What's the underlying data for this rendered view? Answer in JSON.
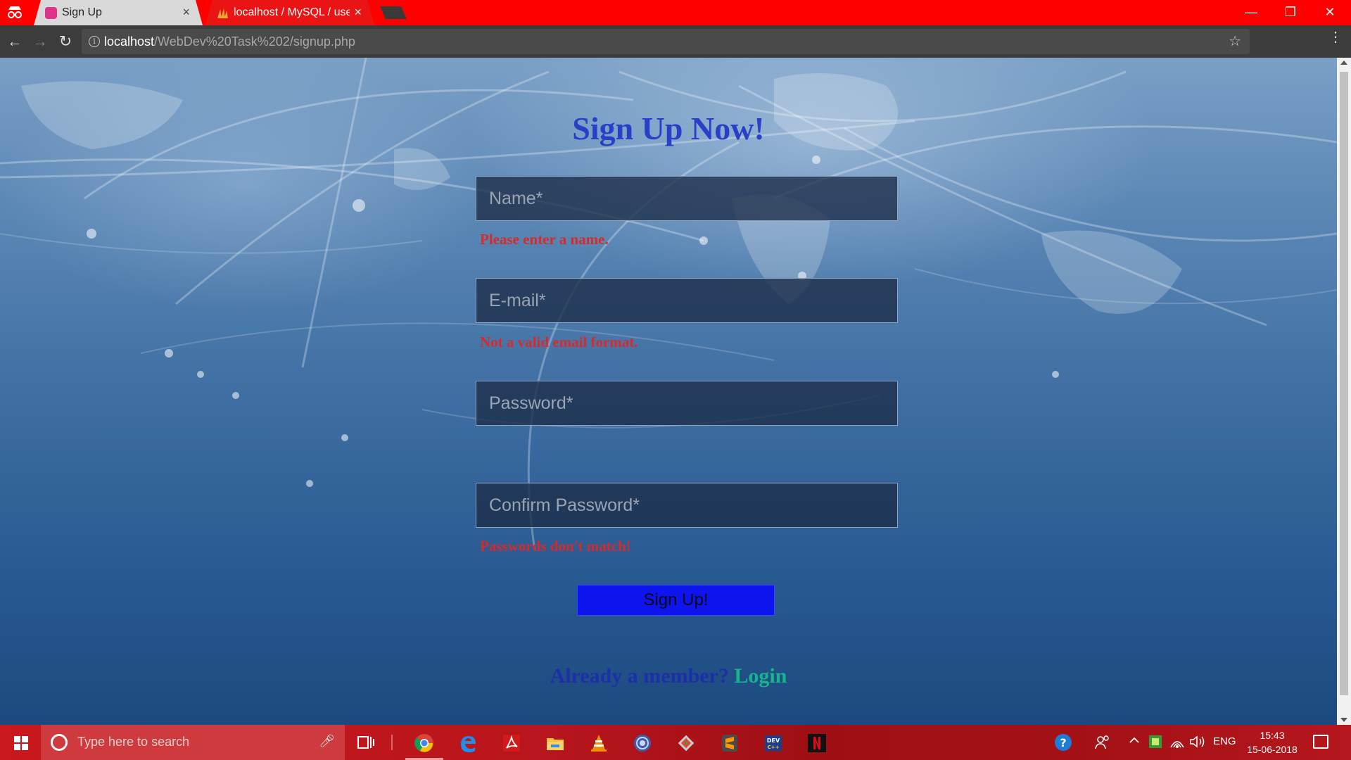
{
  "browser": {
    "tabs": [
      {
        "title": "Sign Up",
        "active": true
      },
      {
        "title": "localhost / MySQL / users",
        "active": false
      }
    ],
    "url_host": "localhost",
    "url_path": "/WebDev%20Task%202/signup.php"
  },
  "page": {
    "heading": "Sign Up Now!",
    "fields": {
      "name_placeholder": "Name*",
      "email_placeholder": "E-mail*",
      "password_placeholder": "Password*",
      "confirm_placeholder": "Confirm Password*"
    },
    "errors": {
      "name": "Please enter a name.",
      "email": "Not a valid email format.",
      "confirm": "Passwords don't match!"
    },
    "submit_label": "Sign Up!",
    "login_question": "Already a member?",
    "login_link": "Login"
  },
  "taskbar": {
    "search_placeholder": "Type here to search",
    "apps": [
      "chrome-icon",
      "edge-icon",
      "acrobat-icon",
      "file-explorer-icon",
      "vlc-icon",
      "app-icon",
      "git-icon",
      "sublime-text-icon",
      "devcpp-icon",
      "netflix-icon"
    ],
    "language": "ENG",
    "time": "15:43",
    "date": "15-06-2018"
  },
  "colors": {
    "heading": "#2a3fc7",
    "error": "#d82a2a",
    "button": "#0d14ee",
    "login_link": "#16b58c",
    "chrome_frame": "#ff0000"
  }
}
